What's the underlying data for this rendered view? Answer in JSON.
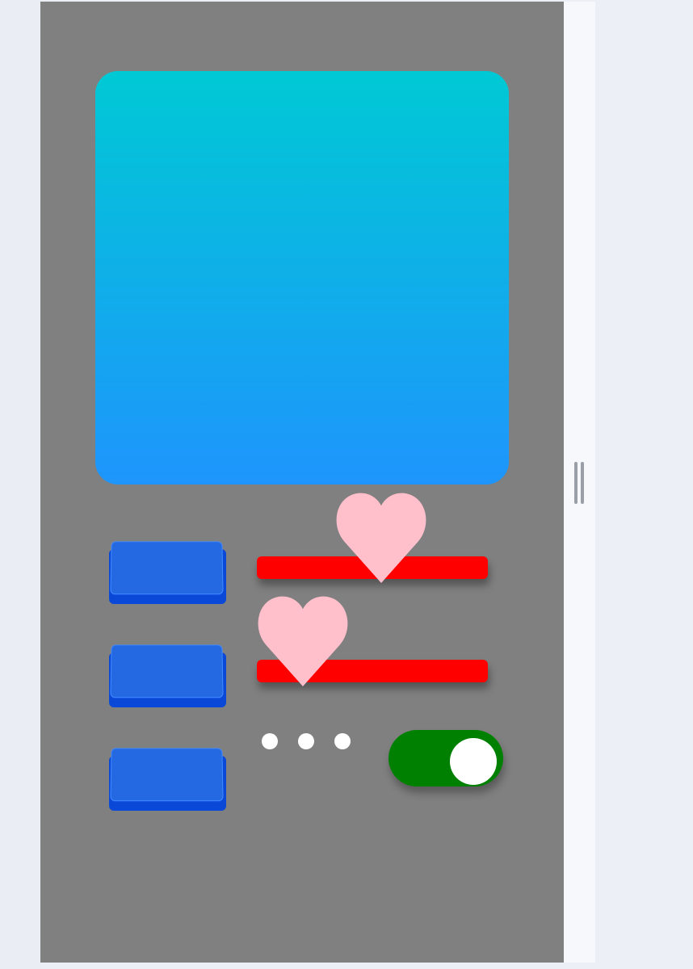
{
  "colors": {
    "canvas": "#808080",
    "page": "#eceff5",
    "side_panel": "#f6f8fc",
    "card_gradient_top": "#00c9d4",
    "card_gradient_bottom": "#1e95fd",
    "button_face": "#2468e2",
    "button_base": "#0a48d8",
    "bar": "#ff0000",
    "heart": "#ffc0cb",
    "toggle_on": "#008000",
    "toggle_knob": "#ffffff",
    "dot": "#ffffff"
  },
  "buttons": [
    {
      "name": "blue-button-1",
      "label": ""
    },
    {
      "name": "blue-button-2",
      "label": ""
    },
    {
      "name": "blue-button-3",
      "label": ""
    }
  ],
  "sliders": [
    {
      "name": "red-slider-1",
      "thumb_icon": "heart-icon"
    },
    {
      "name": "red-slider-2",
      "thumb_icon": "heart-icon"
    }
  ],
  "page_indicator": {
    "count": 3
  },
  "toggle": {
    "state": "on"
  },
  "side_panel": {
    "handle_icon": "resize-handle-icon"
  }
}
